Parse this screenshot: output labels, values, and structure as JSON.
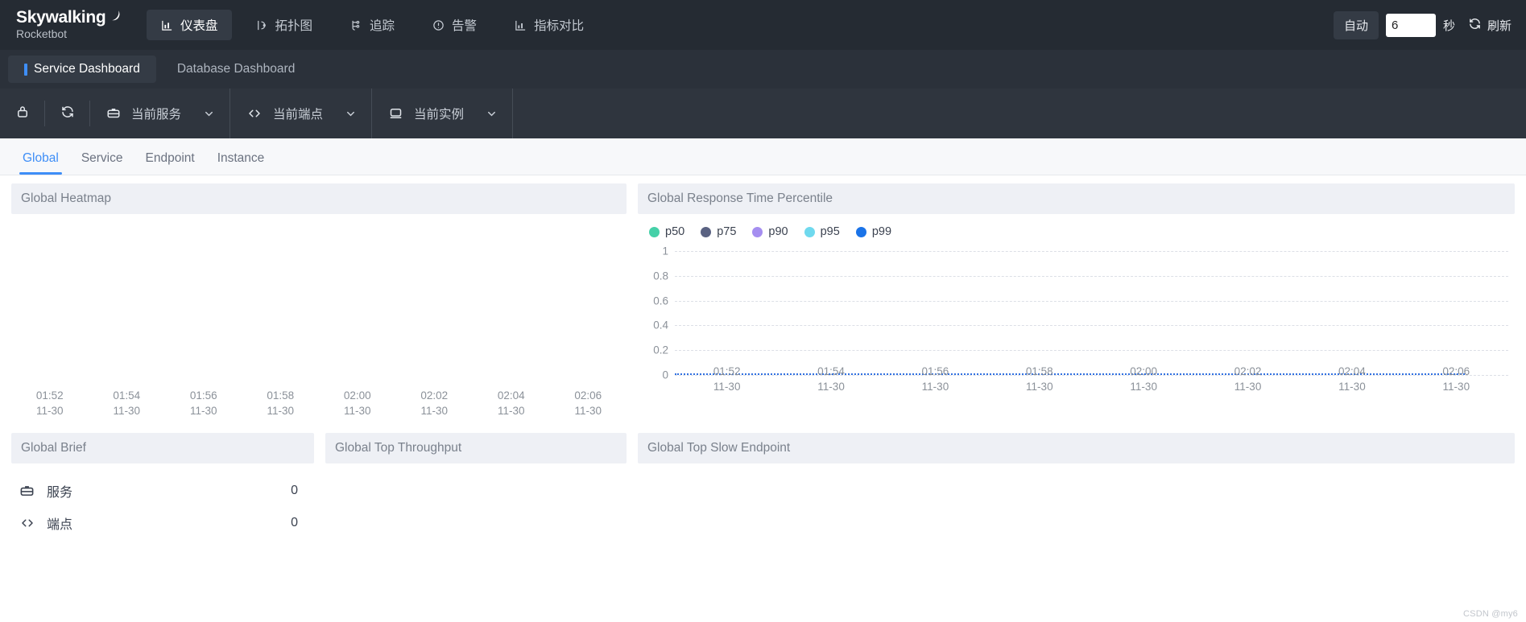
{
  "brand": {
    "main": "Skywalking",
    "sub": "Rocketbot"
  },
  "nav": {
    "items": [
      {
        "label": "仪表盘",
        "icon": "chart-bar-icon",
        "active": true
      },
      {
        "label": "拓扑图",
        "icon": "topology-icon",
        "active": false
      },
      {
        "label": "追踪",
        "icon": "trace-icon",
        "active": false
      },
      {
        "label": "告警",
        "icon": "alarm-icon",
        "active": false
      },
      {
        "label": "指标对比",
        "icon": "compare-icon",
        "active": false
      }
    ]
  },
  "refresh": {
    "auto_label": "自动",
    "interval_value": "6",
    "interval_placeholder": "",
    "unit_label": "秒",
    "refresh_label": "刷新",
    "refresh_icon": "refresh-icon"
  },
  "dashboard_tabs": [
    {
      "label": "Service Dashboard",
      "active": true
    },
    {
      "label": "Database Dashboard",
      "active": false
    }
  ],
  "selector_toolbar": {
    "lock_icon": "lock-icon",
    "reload_icon": "reload-icon",
    "selectors": [
      {
        "label": "当前服务",
        "icon": "service-icon",
        "caret": "chevron-down-icon"
      },
      {
        "label": "当前端点",
        "icon": "endpoint-icon",
        "caret": "chevron-down-icon"
      },
      {
        "label": "当前实例",
        "icon": "instance-icon",
        "caret": "chevron-down-icon"
      }
    ]
  },
  "sub_tabs": [
    {
      "label": "Global",
      "active": true
    },
    {
      "label": "Service",
      "active": false
    },
    {
      "label": "Endpoint",
      "active": false
    },
    {
      "label": "Instance",
      "active": false
    }
  ],
  "panels": {
    "heatmap_title": "Global Heatmap",
    "percentile_title": "Global Response Time Percentile",
    "brief_title": "Global Brief",
    "top_throughput_title": "Global Top Throughput",
    "top_slow_endpoint_title": "Global Top Slow Endpoint"
  },
  "brief": {
    "rows": [
      {
        "icon": "service-icon",
        "name": "服务",
        "value": "0"
      },
      {
        "icon": "endpoint-icon",
        "name": "端点",
        "value": "0"
      }
    ]
  },
  "watermark": "CSDN @my6",
  "colors": {
    "accent": "#3e8ef7",
    "header_bg": "#252b33",
    "toolbar_bg": "#2f353e",
    "panel_head_bg": "#eef0f5"
  },
  "chart_data": [
    {
      "type": "heatmap",
      "title": "Global Heatmap",
      "xlabel": "",
      "ylabel": "",
      "grid": false,
      "x_tick_times": [
        "01:52",
        "01:54",
        "01:56",
        "01:58",
        "02:00",
        "02:02",
        "02:04",
        "02:06"
      ],
      "x_tick_dates": [
        "11-30",
        "11-30",
        "11-30",
        "11-30",
        "11-30",
        "11-30",
        "11-30",
        "11-30"
      ],
      "values": [],
      "note": "no data rendered"
    },
    {
      "type": "line",
      "title": "Global Response Time Percentile",
      "xlabel": "",
      "ylabel": "",
      "grid": true,
      "legend_position": "top-left",
      "ylim": [
        0,
        1
      ],
      "yticks": [
        "0",
        "0.2",
        "0.4",
        "0.6",
        "0.8",
        "1"
      ],
      "x_tick_times": [
        "01:52",
        "01:54",
        "01:56",
        "01:58",
        "02:00",
        "02:02",
        "02:04",
        "02:06"
      ],
      "x_tick_dates": [
        "11-30",
        "11-30",
        "11-30",
        "11-30",
        "11-30",
        "11-30",
        "11-30",
        "11-30"
      ],
      "categories": [
        "01:52",
        "01:54",
        "01:56",
        "01:58",
        "02:00",
        "02:02",
        "02:04",
        "02:06"
      ],
      "series": [
        {
          "name": "p50",
          "color": "#45d0a8",
          "values": [
            0,
            0,
            0,
            0,
            0,
            0,
            0,
            0
          ]
        },
        {
          "name": "p75",
          "color": "#5a6282",
          "values": [
            0,
            0,
            0,
            0,
            0,
            0,
            0,
            0
          ]
        },
        {
          "name": "p90",
          "color": "#a58ef0",
          "values": [
            0,
            0,
            0,
            0,
            0,
            0,
            0,
            0
          ]
        },
        {
          "name": "p95",
          "color": "#6fd9ee",
          "values": [
            0,
            0,
            0,
            0,
            0,
            0,
            0,
            0
          ]
        },
        {
          "name": "p99",
          "color": "#1a73e8",
          "values": [
            0,
            0,
            0,
            0,
            0,
            0,
            0,
            0
          ]
        }
      ]
    }
  ]
}
